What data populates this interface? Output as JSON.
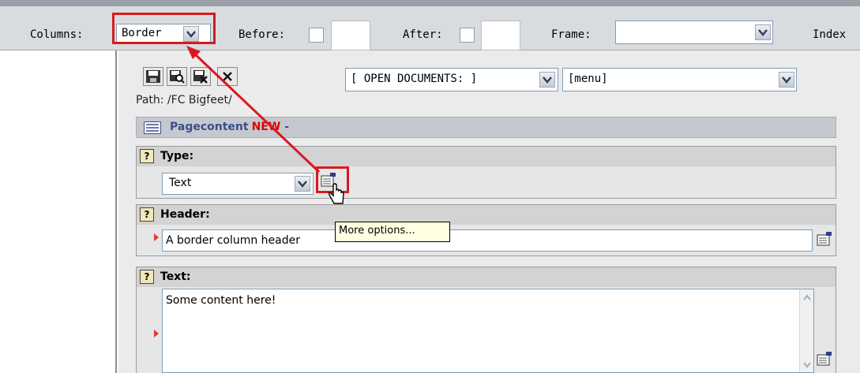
{
  "toolbar": {
    "columns_label": "Columns:",
    "columns_value": "Border",
    "before_label": "Before:",
    "after_label": "After:",
    "frame_label": "Frame:",
    "frame_value": "",
    "index_label": "Index"
  },
  "doc_toolbar": {
    "open_documents_value": "[ OPEN DOCUMENTS: ]",
    "menu_value": "[menu]"
  },
  "path": "Path: /FC Bigfeet/",
  "section": {
    "title": "Pagecontent",
    "new_badge": "NEW",
    "suffix": "-"
  },
  "fields": {
    "type": {
      "label": "Type:",
      "value": "Text"
    },
    "header": {
      "label": "Header:",
      "value": "A border column header"
    },
    "text": {
      "label": "Text:",
      "value": "Some content here!"
    }
  },
  "tooltip": "More options...",
  "colors": {
    "highlight": "#d71a21",
    "section_title": "#3a4f8a",
    "new_badge": "#e00000"
  },
  "icons": [
    "save-icon",
    "save-view-icon",
    "save-close-icon",
    "close-icon",
    "question-icon",
    "more-options-icon",
    "hand-cursor-icon",
    "dropdown-arrow-icon"
  ]
}
